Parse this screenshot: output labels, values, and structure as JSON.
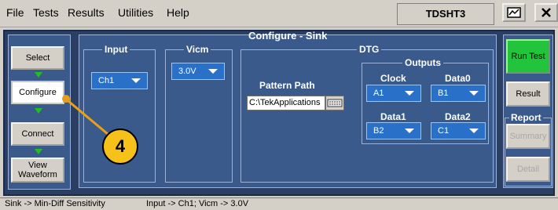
{
  "menubar": {
    "items": [
      "File",
      "Tests",
      "Results",
      "Utilities",
      "Help"
    ],
    "app_title": "TDSHT3"
  },
  "nav": {
    "select_label": "Select",
    "configure_label": "Configure",
    "connect_label": "Connect",
    "view_waveform_label": "View Waveform"
  },
  "content": {
    "title": "Configure - Sink",
    "input": {
      "label": "Input",
      "value": "Ch1"
    },
    "vicm": {
      "label": "Vicm",
      "value": "3.0V"
    },
    "dtg": {
      "label": "DTG",
      "pattern_path_label": "Pattern Path",
      "pattern_path_value": "C:\\TekApplications",
      "outputs": {
        "label": "Outputs",
        "clock": {
          "label": "Clock",
          "value": "A1"
        },
        "data0": {
          "label": "Data0",
          "value": "B1"
        },
        "data1": {
          "label": "Data1",
          "value": "B2"
        },
        "data2": {
          "label": "Data2",
          "value": "C1"
        }
      }
    }
  },
  "side": {
    "run_test_label": "Run Test",
    "result_label": "Result",
    "report_label": "Report",
    "summary_label": "Summary",
    "detail_label": "Detail"
  },
  "status": {
    "left": "Sink -> Min-Diff Sensitivity",
    "right": "Input -> Ch1; Vicm -> 3.0V"
  },
  "callout": {
    "number": "4"
  },
  "colors": {
    "panel_bg": "#3a5a8c",
    "frame_bg": "#2a3f63",
    "dropdown_bg": "#2870c8",
    "run_green": "#21c43a",
    "callout_yellow": "#f6c21a"
  }
}
